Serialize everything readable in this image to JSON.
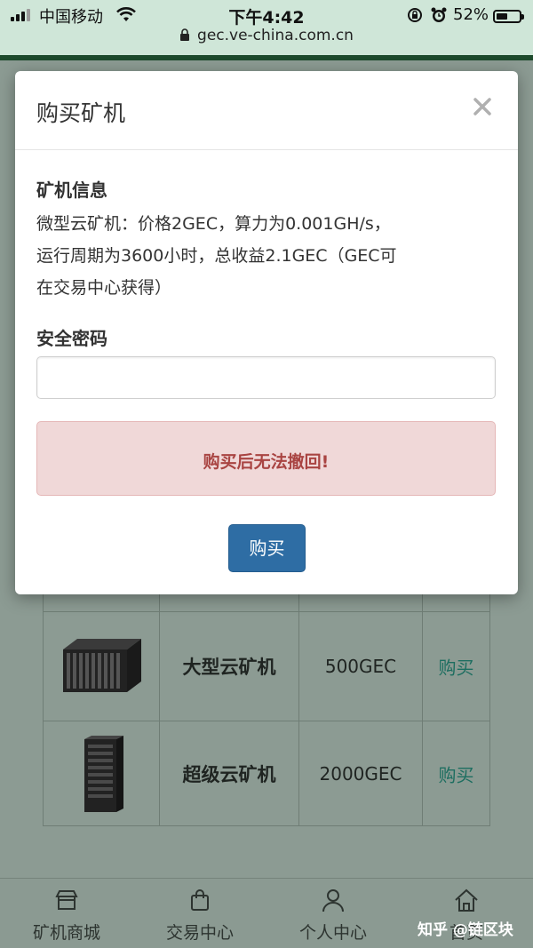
{
  "status": {
    "carrier": "中国移动",
    "time": "下午4:42",
    "battery": "52%",
    "battery_level": 0.52,
    "icons": [
      "signal-icon",
      "wifi-icon",
      "rotation-lock-icon",
      "alarm-icon",
      "battery-icon"
    ]
  },
  "browser": {
    "url": "gec.ve-china.com.cn"
  },
  "modal": {
    "title": "购买矿机",
    "close": "×",
    "info_title": "矿机信息",
    "info_lines": [
      "微型云矿机：价格2GEC，算力为0.001GH/s，",
      "运行周期为3600小时，总收益2.1GEC（GEC可",
      "在交易中心获得）"
    ],
    "password_label": "安全密码",
    "password_value": "",
    "warning": "购买后无法撤回!",
    "buy_button": "购买"
  },
  "products": [
    {
      "name": "大型云矿机",
      "price": "500GEC",
      "action": "购买"
    },
    {
      "name": "超级云矿机",
      "price": "2000GEC",
      "action": "购买"
    }
  ],
  "nav": [
    {
      "label": "矿机商城",
      "icon": "store-icon"
    },
    {
      "label": "交易中心",
      "icon": "shopping-bag-icon"
    },
    {
      "label": "个人中心",
      "icon": "user-icon"
    },
    {
      "label": "首页",
      "icon": "home-icon"
    }
  ],
  "watermark": "知乎 @链区块",
  "colors": {
    "primary": "#2e6da4",
    "danger_text": "#a94442",
    "danger_bg": "#f0d8d8",
    "link": "#1d6e60"
  }
}
